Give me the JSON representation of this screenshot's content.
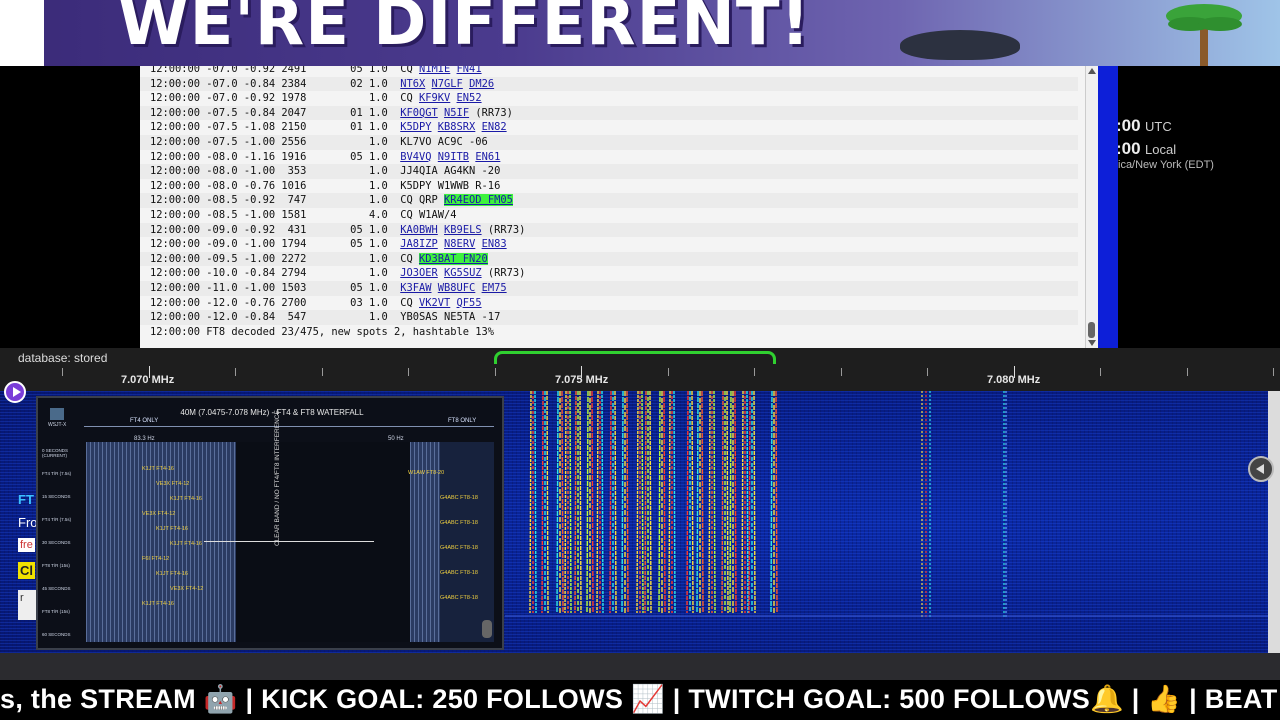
{
  "banner": {
    "title": "WE'RE DIFFERENT!"
  },
  "clocks": [
    {
      "time": ":00",
      "zone": "UTC"
    },
    {
      "time": ":00",
      "zone": "Local"
    }
  ],
  "clock_tz": "ica/New York (EDT)",
  "log": {
    "lines": [
      [
        {
          "t": "12:00:00 -07.0 -0.92 2491       05 1.0  CQ "
        },
        {
          "t": "N1MIE",
          "c": 1
        },
        {
          "t": " "
        },
        {
          "t": "FN41",
          "c": 1
        }
      ],
      [
        {
          "t": "12:00:00 -07.0 -0.84 2384       02 1.0  "
        },
        {
          "t": "NT6X",
          "c": 1
        },
        {
          "t": " "
        },
        {
          "t": "N7GLF",
          "c": 1
        },
        {
          "t": " "
        },
        {
          "t": "DM26",
          "c": 1
        }
      ],
      [
        {
          "t": "12:00:00 -07.0 -0.92 1978          1.0  CQ "
        },
        {
          "t": "KF9KV",
          "c": 1
        },
        {
          "t": " "
        },
        {
          "t": "EN52",
          "c": 1
        }
      ],
      [
        {
          "t": "12:00:00 -07.5 -0.84 2047       01 1.0  "
        },
        {
          "t": "KF0QGT",
          "c": 1
        },
        {
          "t": " "
        },
        {
          "t": "N5IF",
          "c": 1
        },
        {
          "t": " (RR73)"
        }
      ],
      [
        {
          "t": "12:00:00 -07.5 -1.08 2150       01 1.0  "
        },
        {
          "t": "K5DPY",
          "c": 1
        },
        {
          "t": " "
        },
        {
          "t": "KB8SRX",
          "c": 1
        },
        {
          "t": " "
        },
        {
          "t": "EN82",
          "c": 1
        }
      ],
      [
        {
          "t": "12:00:00 -07.5 -1.00 2556          1.0  KL7VO AC9C -06"
        }
      ],
      [
        {
          "t": "12:00:00 -08.0 -1.16 1916       05 1.0  "
        },
        {
          "t": "BV4VQ",
          "c": 1
        },
        {
          "t": " "
        },
        {
          "t": "N9ITB",
          "c": 1
        },
        {
          "t": " "
        },
        {
          "t": "EN61",
          "c": 1
        }
      ],
      [
        {
          "t": "12:00:00 -08.0 -1.00  353          1.0  JJ4QIA AG4KN -20"
        }
      ],
      [
        {
          "t": "12:00:00 -08.0 -0.76 1016          1.0  K5DPY W1WWB R-16"
        }
      ],
      [
        {
          "t": "12:00:00 -08.5 -0.92  747          1.0  CQ QRP "
        },
        {
          "t": "KR4EOD FM05",
          "h": 1
        }
      ],
      [
        {
          "t": "12:00:00 -08.5 -1.00 1581          4.0  CQ W1AW/4"
        }
      ],
      [
        {
          "t": "12:00:00 -09.0 -0.92  431       05 1.0  "
        },
        {
          "t": "KA0BWH",
          "c": 1
        },
        {
          "t": " "
        },
        {
          "t": "KB9ELS",
          "c": 1
        },
        {
          "t": " (RR73)"
        }
      ],
      [
        {
          "t": "12:00:00 -09.0 -1.00 1794       05 1.0  "
        },
        {
          "t": "JA8IZP",
          "c": 1
        },
        {
          "t": " "
        },
        {
          "t": "N8ERV",
          "c": 1
        },
        {
          "t": " "
        },
        {
          "t": "EN83",
          "c": 1
        }
      ],
      [
        {
          "t": "12:00:00 -09.5 -1.00 2272          1.0  CQ "
        },
        {
          "t": "KD3BAT FN20",
          "h": 1
        }
      ],
      [
        {
          "t": "12:00:00 -10.0 -0.84 2794          1.0  "
        },
        {
          "t": "JO3OER",
          "c": 1
        },
        {
          "t": " "
        },
        {
          "t": "KG5SUZ",
          "c": 1
        },
        {
          "t": " (RR73)"
        }
      ],
      [
        {
          "t": "12:00:00 -11.0 -1.00 1503       05 1.0  "
        },
        {
          "t": "K3FAW",
          "c": 1
        },
        {
          "t": " "
        },
        {
          "t": "WB8UFC",
          "c": 1
        },
        {
          "t": " "
        },
        {
          "t": "EM75",
          "c": 1
        }
      ],
      [
        {
          "t": "12:00:00 -12.0 -0.76 2700       03 1.0  CQ "
        },
        {
          "t": "VK2VT",
          "c": 1
        },
        {
          "t": " "
        },
        {
          "t": "QF55",
          "c": 1
        }
      ],
      [
        {
          "t": "12:00:00 -12.0 -0.84  547          1.0  YB0SAS NE5TA -17"
        }
      ],
      [
        {
          "t": "12:00:00 FT8 decoded 23/475, new spots 2, hashtable 13%"
        }
      ]
    ]
  },
  "scale": {
    "status": "database: stored",
    "freqs": [
      "7.070 MHz",
      "7.075 MHz",
      "7.080 MHz"
    ]
  },
  "card": {
    "title": "40M (7.0475-7.078 MHz) - FT4 & FT8 WATERFALL",
    "ft4_label": "FT4 ONLY",
    "ft8_label": "FT8 ONLY",
    "center_label": "CLEAR BAND / NO FT4/FT8 INTERFERENCE",
    "logo": "WSJT-X",
    "left_marks": [
      "0 SECONDS (CURRENT)",
      "FT4 T/R (7.5s)",
      "15 SECONDS",
      "FT4 T/R (7.5s)",
      "30 SECONDS",
      "FT8 T/R (15s)",
      "45 SECONDS",
      "FT8 T/R (15s)",
      "60 SECONDS"
    ],
    "ft4_signals": [
      "K1JT FT4-16",
      "VE3X FT4-12",
      "K1JT FT4-16",
      "VE3X FT4-12",
      "K1JT FT4-16",
      "K1JT FT4-16",
      "F6I FT4-12",
      "K1JT FT4-16",
      "VE3X FT4-12",
      "K1JT FT4-16"
    ],
    "ft8_signals": [
      "W1AW FT8-20",
      "G4ABC FT8-18",
      "G4ABC FT8-18",
      "G4ABC FT8-18",
      "G4ABC FT8-18",
      "G4ABC FT8-18"
    ],
    "ft4_bw": "83.3 Hz",
    "ft8_bw": "50 Hz"
  },
  "chat": {
    "a": "FT",
    "b": "Fro",
    "c": "fre",
    "d": "Cl",
    "e": "r"
  },
  "ticker": {
    "text": "s, the STREAM 🤖 | KICK GOAL: 250 FOLLOWS 📈 | TWITCH GOAL: 500 FOLLOWS🔔 | 👍 | BEAT T"
  },
  "colors": {
    "passband": "#30d030",
    "highlight": "#3ef23e",
    "callsign": "#1a1aa6",
    "waterfall_bg": "#071d86"
  }
}
